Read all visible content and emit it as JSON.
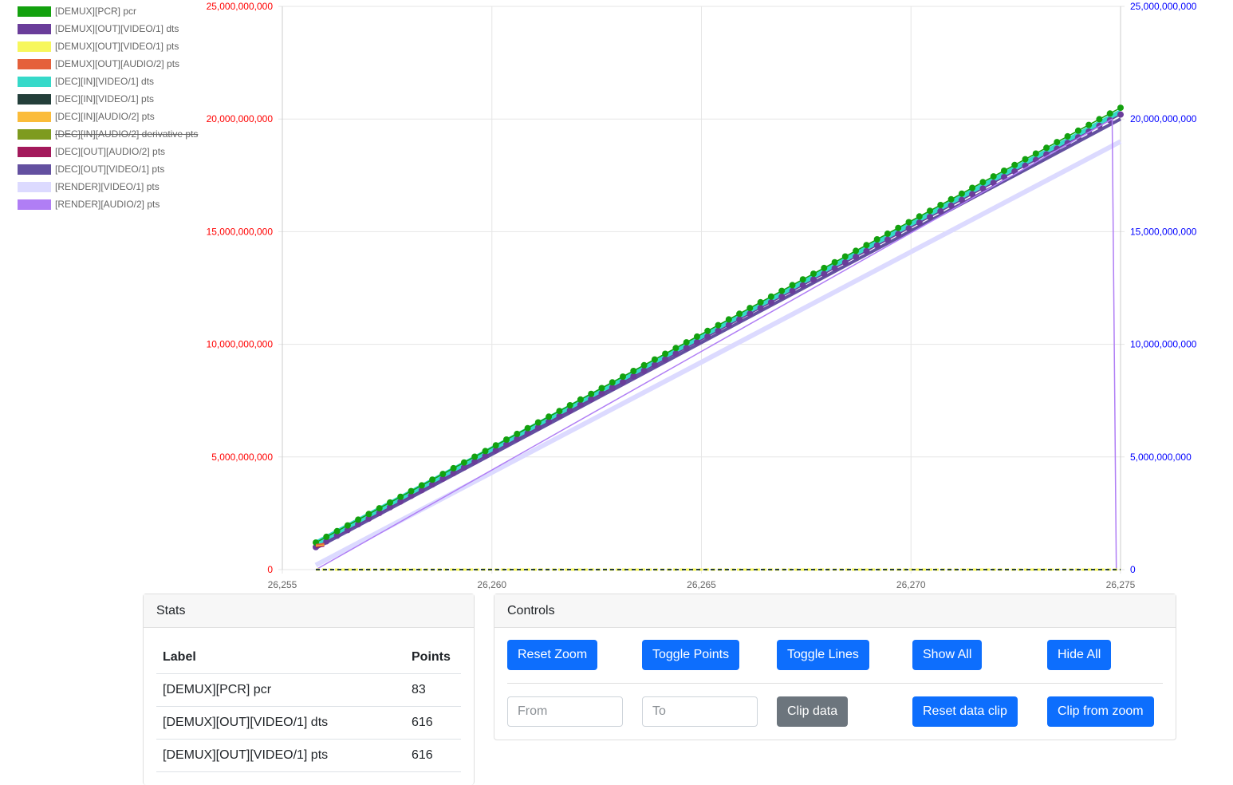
{
  "chart_data": {
    "type": "line",
    "x_ticks": [
      "26,255",
      "26,260",
      "26,265",
      "26,270",
      "26,275"
    ],
    "xlim": [
      26255,
      26275
    ],
    "y_left_ticks": [
      "0",
      "5,000,000,000",
      "10,000,000,000",
      "15,000,000,000",
      "20,000,000,000",
      "25,000,000,000"
    ],
    "y_right_ticks": [
      "0",
      "5,000,000,000",
      "10,000,000,000",
      "15,000,000,000",
      "20,000,000,000",
      "25,000,000,000"
    ],
    "ylim": [
      0,
      25000000000
    ],
    "left_axis_color": "#ff0000",
    "right_axis_color": "#0000ff",
    "grid": true,
    "legend_position": "top-left",
    "series": [
      {
        "name": "[DEMUX][PCR] pcr",
        "color": "#13a10e",
        "hidden": false,
        "points": [
          [
            26255.8,
            1200000000
          ],
          [
            26275.0,
            20500000000
          ]
        ]
      },
      {
        "name": "[DEMUX][OUT][VIDEO/1] dts",
        "color": "#6a3d9a",
        "hidden": false,
        "points": [
          [
            26255.8,
            1000000000
          ],
          [
            26275.0,
            20200000000
          ]
        ]
      },
      {
        "name": "[DEMUX][OUT][VIDEO/1] pts",
        "color": "#f7f75c",
        "hidden": false,
        "points": [
          [
            26255.8,
            0
          ],
          [
            26275.0,
            0
          ]
        ]
      },
      {
        "name": "[DEMUX][OUT][AUDIO/2] pts",
        "color": "#e5603b",
        "hidden": false,
        "points": [
          [
            26255.8,
            1100000000
          ],
          [
            26256.0,
            1150000000
          ]
        ]
      },
      {
        "name": "[DEC][IN][VIDEO/1] dts",
        "color": "#36d9c9",
        "hidden": false,
        "points": [
          [
            26255.8,
            1150000000
          ],
          [
            26275.0,
            20300000000
          ]
        ]
      },
      {
        "name": "[DEC][IN][VIDEO/1] pts",
        "color": "#233f3a",
        "hidden": false,
        "points": [
          [
            26255.8,
            0
          ],
          [
            26275.0,
            0
          ]
        ]
      },
      {
        "name": "[DEC][IN][AUDIO/2] pts",
        "color": "#fbbc3a",
        "hidden": false,
        "points": [
          [
            26255.8,
            1050000000
          ],
          [
            26256.0,
            1100000000
          ]
        ]
      },
      {
        "name": "[DEC][IN][AUDIO/2] derivative pts",
        "color": "#7e9b1f",
        "hidden": true,
        "points": []
      },
      {
        "name": "[DEC][OUT][AUDIO/2] pts",
        "color": "#a3195b",
        "hidden": false,
        "points": [
          [
            26255.8,
            1000000000
          ],
          [
            26256.0,
            1050000000
          ]
        ]
      },
      {
        "name": "[DEC][OUT][VIDEO/1] pts",
        "color": "#6350a0",
        "hidden": false,
        "points": [
          [
            26255.8,
            950000000
          ],
          [
            26275.0,
            20000000000
          ]
        ]
      },
      {
        "name": "[RENDER][VIDEO/1] pts",
        "color": "#dcdaff",
        "hidden": false,
        "points": [
          [
            26255.8,
            200000000
          ],
          [
            26275.0,
            19000000000
          ]
        ]
      },
      {
        "name": "[RENDER][AUDIO/2] pts",
        "color": "#b07ef5",
        "hidden": false,
        "points": [
          [
            26255.8,
            0
          ],
          [
            26274.8,
            20000000000
          ],
          [
            26274.9,
            0
          ]
        ]
      }
    ]
  },
  "stats": {
    "title": "Stats",
    "headers": {
      "label": "Label",
      "points": "Points"
    },
    "rows": [
      {
        "label": "[DEMUX][PCR] pcr",
        "points": "83"
      },
      {
        "label": "[DEMUX][OUT][VIDEO/1] dts",
        "points": "616"
      },
      {
        "label": "[DEMUX][OUT][VIDEO/1] pts",
        "points": "616"
      }
    ]
  },
  "controls": {
    "title": "Controls",
    "reset_zoom": "Reset Zoom",
    "toggle_points": "Toggle Points",
    "toggle_lines": "Toggle Lines",
    "show_all": "Show All",
    "hide_all": "Hide All",
    "from_placeholder": "From",
    "to_placeholder": "To",
    "clip_data": "Clip data",
    "reset_clip": "Reset data clip",
    "clip_from_zoom": "Clip from zoom"
  }
}
